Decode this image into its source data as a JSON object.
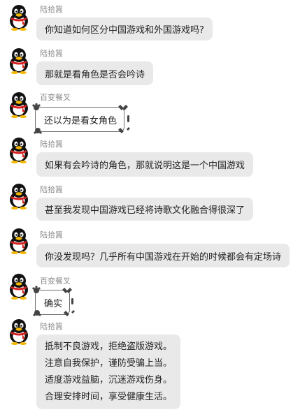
{
  "messages": [
    {
      "sender": "陆拾篙",
      "lines": [
        "你知道如何区分中国游戏和外国游戏吗?"
      ],
      "style": "normal"
    },
    {
      "sender": "陆拾篙",
      "lines": [
        "那就是看角色是否会吟诗"
      ],
      "style": "normal"
    },
    {
      "sender": "百变餐叉",
      "lines": [
        "还以为是看女角色"
      ],
      "style": "fancy"
    },
    {
      "sender": "陆拾篙",
      "lines": [
        "如果有会吟诗的角色，那就说明这是一个中国游戏"
      ],
      "style": "normal"
    },
    {
      "sender": "陆拾篙",
      "lines": [
        "甚至我发现中国游戏已经将诗歌文化融合得很深了"
      ],
      "style": "normal"
    },
    {
      "sender": "陆拾篙",
      "lines": [
        "你没发现吗？几乎所有中国游戏在开始的时候都会有定场诗"
      ],
      "style": "normal"
    },
    {
      "sender": "百变餐叉",
      "lines": [
        "确实"
      ],
      "style": "fancy"
    },
    {
      "sender": "陆拾篙",
      "lines": [
        "抵制不良游戏，拒绝盗版游戏。",
        "注意自我保护，谨防受骗上当。",
        "适度游戏益脑，沉迷游戏伤身。",
        "合理安排时间，享受健康生活。"
      ],
      "style": "normal"
    }
  ],
  "colors": {
    "bubble": "#e9e9e9",
    "sender": "#8b8b8b",
    "text": "#222222"
  },
  "icons": {
    "avatar": "qq-penguin-avatar-icon",
    "fancy_frame": "cat-paw-bubble-frame-icon"
  }
}
